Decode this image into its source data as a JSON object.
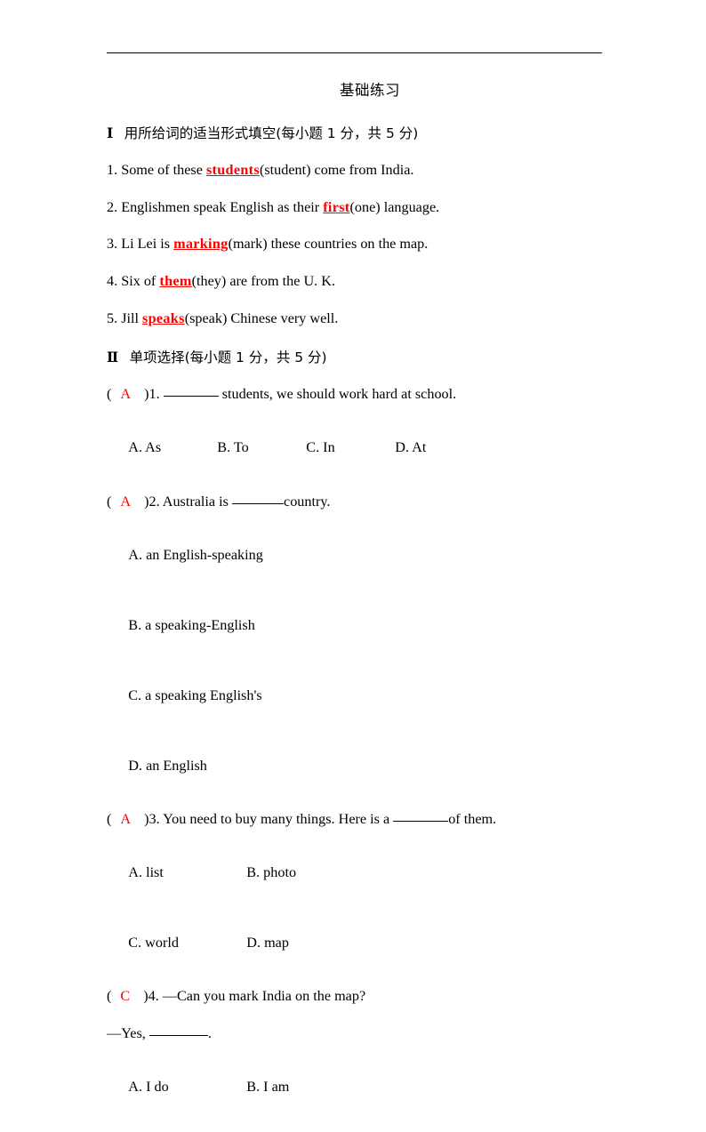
{
  "document": {
    "title": "基础练习"
  },
  "sections": [
    {
      "roman": "Ⅰ",
      "heading": "用所给词的适当形式填空(每小题 1 分，共 5 分)",
      "questions": [
        {
          "number": "1.",
          "before": " Some of these ",
          "answer": "students",
          "after": "(student) come from India."
        },
        {
          "number": "2.",
          "before": " Englishmen speak English as their ",
          "answer": "first",
          "after": "(one) language."
        },
        {
          "number": "3.",
          "before": " Li Lei is ",
          "answer": "marking",
          "after": "(mark) these countries on the map."
        },
        {
          "number": "4.",
          "before": " Six of ",
          "answer": "them",
          "after": "(they) are from the U. K."
        },
        {
          "number": "5.",
          "before": " Jill ",
          "answer": "speaks",
          "after": "(speak) Chinese very well."
        }
      ]
    },
    {
      "roman": "Ⅱ",
      "heading": "单项选择(每小题 1 分，共 5 分)",
      "questions": [
        {
          "open_paren": "(",
          "answer_letter": "A",
          "close_paren": ")",
          "number": "1.",
          "stem_before": " ",
          "stem_after": " students, we should work hard at school.",
          "options": [
            "A. As",
            "B. To",
            "C. In",
            "D. At"
          ],
          "option_layout": "cols4"
        },
        {
          "open_paren": "(",
          "answer_letter": "A",
          "close_paren": ")",
          "number": "2.",
          "stem_before": " Australia is ",
          "stem_after": "country.",
          "options": [
            "A. an English-speaking",
            "B. a speaking-English",
            "C. a speaking English's",
            "D. an English"
          ],
          "option_layout": "cols1"
        },
        {
          "open_paren": "(",
          "answer_letter": "A",
          "close_paren": ")",
          "number": "3.",
          "stem_before": " You need to buy many things. Here is a ",
          "stem_after": "of them.",
          "options": [
            "A. list",
            "B. photo",
            "C. world",
            "D. map"
          ],
          "option_layout": "cols2"
        },
        {
          "open_paren": "(",
          "answer_letter": "C",
          "close_paren": ")",
          "number": "4.",
          "stem_before": " —Can you mark India on the map?",
          "stem_after": "",
          "continuation_before": "—Yes,  ",
          "continuation_after": ".",
          "options": [
            "A. I do",
            "B. I am"
          ],
          "option_layout": "cols2"
        }
      ]
    }
  ]
}
